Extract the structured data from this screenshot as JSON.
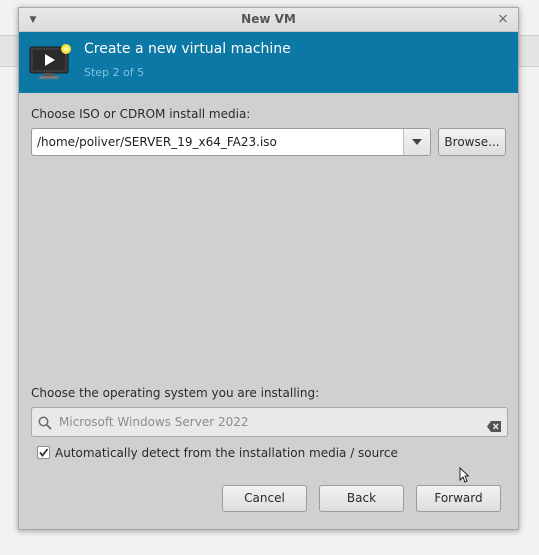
{
  "window": {
    "title": "New VM"
  },
  "banner": {
    "title": "Create a new virtual machine",
    "step": "Step 2 of 5",
    "icon": "monitor-play-icon",
    "background": "#0c78a5"
  },
  "install_media": {
    "label": "Choose ISO or CDROM install media:",
    "value": "/home/poliver/SERVER_19_x64_FA23.iso",
    "browse_label": "Browse..."
  },
  "os": {
    "label": "Choose the operating system you are installing:",
    "placeholder": "Microsoft Windows Server 2022",
    "auto_detect_checked": true,
    "auto_detect_label": "Automatically detect from the installation media / source"
  },
  "buttons": {
    "cancel": "Cancel",
    "back": "Back",
    "forward": "Forward"
  }
}
